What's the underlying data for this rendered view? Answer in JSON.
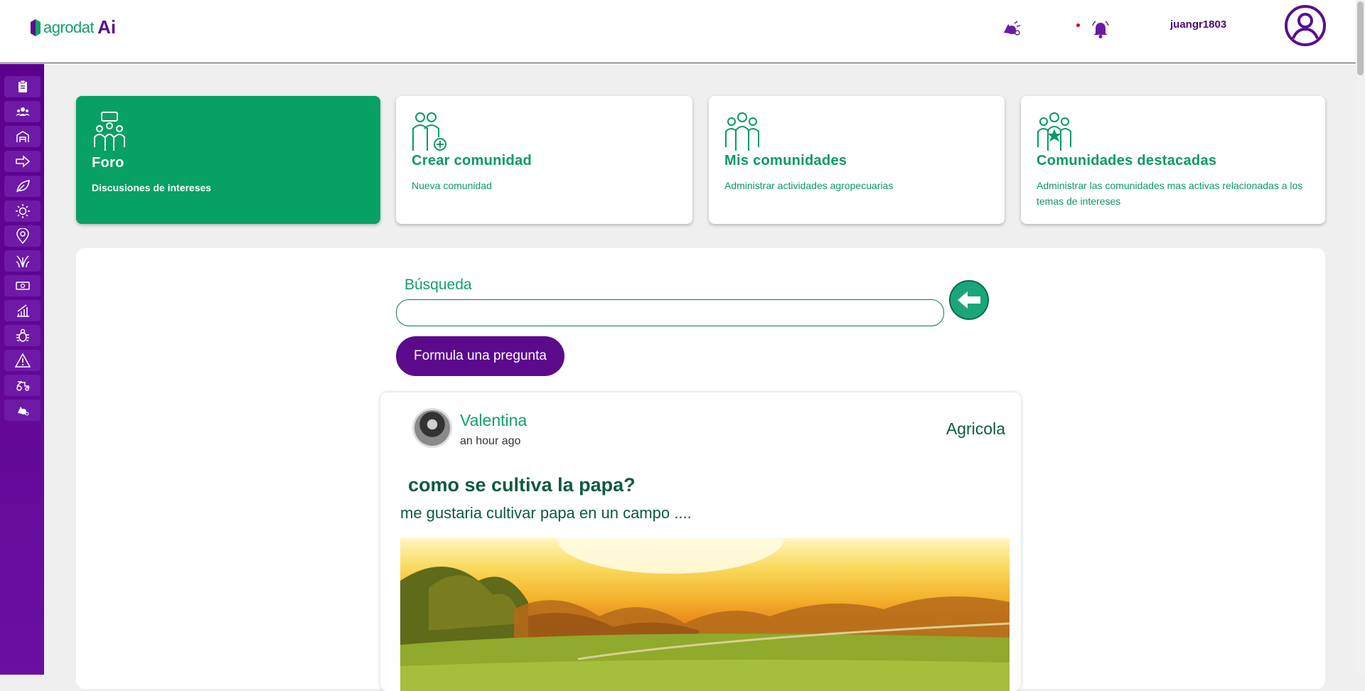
{
  "header": {
    "logo_text": "agrodat",
    "logo_ai": "Ai",
    "username": "juangr1803"
  },
  "sidebar": {
    "items": [
      {
        "icon": "clipboard-icon"
      },
      {
        "icon": "community-icon"
      },
      {
        "icon": "barn-icon"
      },
      {
        "icon": "arrow-right-icon"
      },
      {
        "icon": "leaf-icon"
      },
      {
        "icon": "sun-icon"
      },
      {
        "icon": "location-pin-icon"
      },
      {
        "icon": "plant-icon"
      },
      {
        "icon": "money-icon"
      },
      {
        "icon": "growth-chart-icon"
      },
      {
        "icon": "bug-icon"
      },
      {
        "icon": "warning-icon"
      },
      {
        "icon": "tractor-icon"
      },
      {
        "icon": "forum-icon"
      }
    ]
  },
  "cards": [
    {
      "title": "Foro",
      "subtitle": "Discusiones de intereses"
    },
    {
      "title": "Crear comunidad",
      "subtitle": "Nueva comunidad"
    },
    {
      "title": "Mis comunidades",
      "subtitle": "Administrar actividades agropecuarias"
    },
    {
      "title": "Comunidades destacadas",
      "subtitle": "Administrar las comunidades mas activas relacionadas a los temas de intereses"
    }
  ],
  "search": {
    "label": "Búsqueda",
    "value": "",
    "placeholder": ""
  },
  "ask_button": "Formula una pregunta",
  "post": {
    "author": "Valentina",
    "time": "an hour ago",
    "category": "Agricola",
    "title": "como se cultiva la papa?",
    "body": "me gustaria cultivar papa en un campo ...."
  },
  "colors": {
    "primary_green": "#07a065",
    "primary_purple": "#5b0a8c"
  }
}
